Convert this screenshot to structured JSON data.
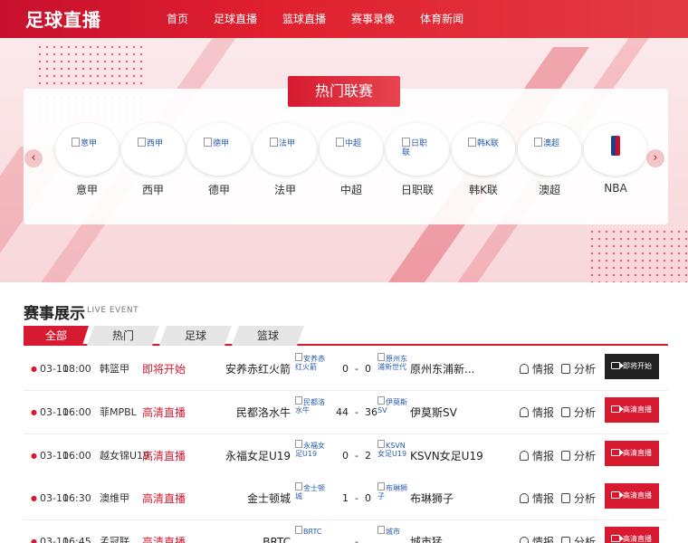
{
  "header": {
    "logo": "足球直播",
    "nav": [
      "首页",
      "足球直播",
      "篮球直播",
      "赛事录像",
      "体育新闻"
    ]
  },
  "hot": {
    "title": "热门联赛",
    "prev": "‹",
    "next": "›",
    "leagues": [
      {
        "img_alt": "意甲",
        "name": "意甲"
      },
      {
        "img_alt": "西甲",
        "name": "西甲"
      },
      {
        "img_alt": "德甲",
        "name": "德甲"
      },
      {
        "img_alt": "法甲",
        "name": "法甲"
      },
      {
        "img_alt": "中超",
        "name": "中超"
      },
      {
        "img_alt": "日职联",
        "name": "日职联"
      },
      {
        "img_alt": "韩K联",
        "name": "韩K联"
      },
      {
        "img_alt": "澳超",
        "name": "澳超"
      },
      {
        "img_alt": "",
        "name": "NBA"
      }
    ]
  },
  "events": {
    "title": "赛事展示",
    "subtitle": "LIVE EVENT",
    "tabs": [
      "全部",
      "热门",
      "足球",
      "篮球"
    ],
    "info_label": "情报",
    "analysis_label": "分析",
    "rows": [
      {
        "date": "03-10",
        "time": "18:00",
        "league": "韩篮甲",
        "status": "即将开始",
        "home": "安养赤红火箭",
        "home_img": "安养赤红火箭",
        "home_score": "0",
        "away_score": "0",
        "away_img": "原州东浦新世代",
        "away": "原州东浦新...",
        "button": "即将开始",
        "dark": true
      },
      {
        "date": "03-10",
        "time": "16:00",
        "league": "菲MPBL",
        "status": "高清直播",
        "home": "民都洛水牛",
        "home_img": "民都洛水牛",
        "home_score": "44",
        "away_score": "36",
        "away_img": "伊莫斯SV",
        "away": "伊莫斯SV",
        "button": "高清直播",
        "dark": false
      },
      {
        "date": "03-10",
        "time": "16:00",
        "league": "越女锦U19",
        "status": "高清直播",
        "home": "永福女足U19",
        "home_img": "永福女足U19",
        "home_score": "0",
        "away_score": "2",
        "away_img": "KSVN女足U19",
        "away": "KSVN女足U19",
        "button": "高清直播",
        "dark": false
      },
      {
        "date": "03-10",
        "time": "16:30",
        "league": "澳维甲",
        "status": "高清直播",
        "home": "金士顿城",
        "home_img": "金士顿城",
        "home_score": "1",
        "away_score": "0",
        "away_img": "布琳狮子",
        "away": "布琳狮子",
        "button": "高清直播",
        "dark": false
      },
      {
        "date": "03-10",
        "time": "16:45",
        "league": "孟冠联",
        "status": "高清直播",
        "home": "BRTC",
        "home_img": "BRTC",
        "home_score": "",
        "away_score": "",
        "away_img": "城市",
        "away": "城市猛",
        "button": "高清直播",
        "dark": false
      }
    ]
  }
}
